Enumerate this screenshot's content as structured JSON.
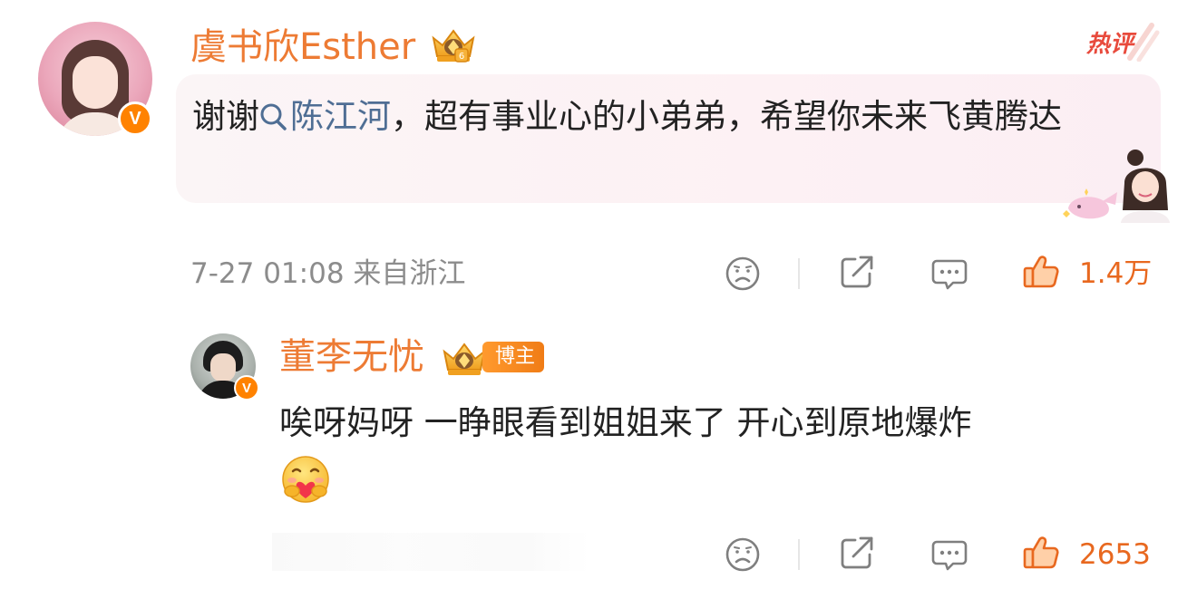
{
  "comments": [
    {
      "author": "虞书欣Esther",
      "badge_hot": "热评",
      "text_before": "谢谢",
      "topic": "陈江河",
      "text_after": "，超有事业心的小弟弟，希望你未来飞黄腾达",
      "time": "7-27 01:08",
      "location": "来自浙江",
      "likes": "1.4万"
    },
    {
      "author": "董李无忧",
      "role_tag": "博主",
      "text": "唉呀妈呀 一睁眼看到姐姐来了 开心到原地爆炸",
      "likes": "2653"
    }
  ],
  "verified_mark": "V",
  "icons": {
    "dislike": "sad-face-icon",
    "share": "share-icon",
    "reply": "comment-icon",
    "like": "thumbs-up-icon",
    "search": "search-icon",
    "crown": "crown-icon",
    "emoji": "hug-heart-emoji"
  },
  "colors": {
    "name": "#ed7b34",
    "topic": "#4f6e94",
    "like": "#e8681f",
    "meta": "#8c8c8c",
    "hot": "#e84a3c"
  }
}
